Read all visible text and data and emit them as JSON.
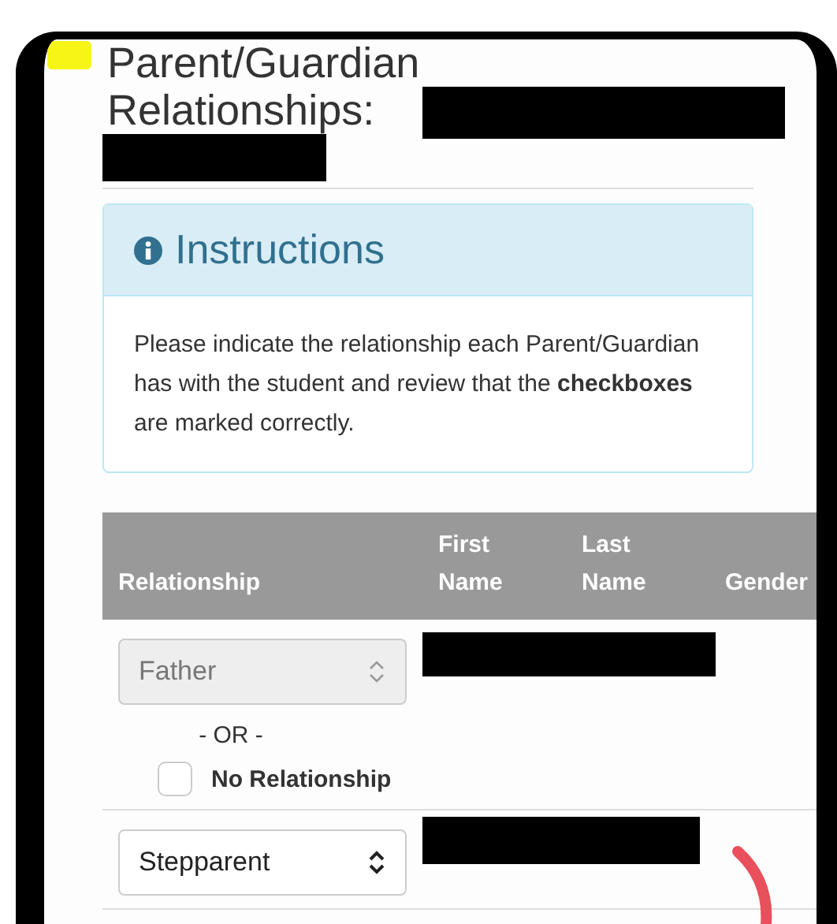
{
  "heading": {
    "title": "Parent/Guardian Relationships:",
    "title_redacted": true,
    "highlighted": true
  },
  "instructions": {
    "title": "Instructions",
    "text": "Please indicate the relationship each Parent/Guardian has with the student and review that the **checkboxes** are marked correctly."
  },
  "table": {
    "columns": [
      "Relationship",
      "First Name",
      "Last Name",
      "Gender"
    ],
    "rows": [
      {
        "relationship": "Father",
        "disabled": true,
        "name_redacted": true,
        "or_label": "- OR -",
        "no_relationship": {
          "label": "No Relationship",
          "checked": false
        }
      },
      {
        "relationship": "Stepparent",
        "disabled": false,
        "name_redacted": true
      }
    ]
  },
  "annotation": {
    "kind": "curve"
  }
}
